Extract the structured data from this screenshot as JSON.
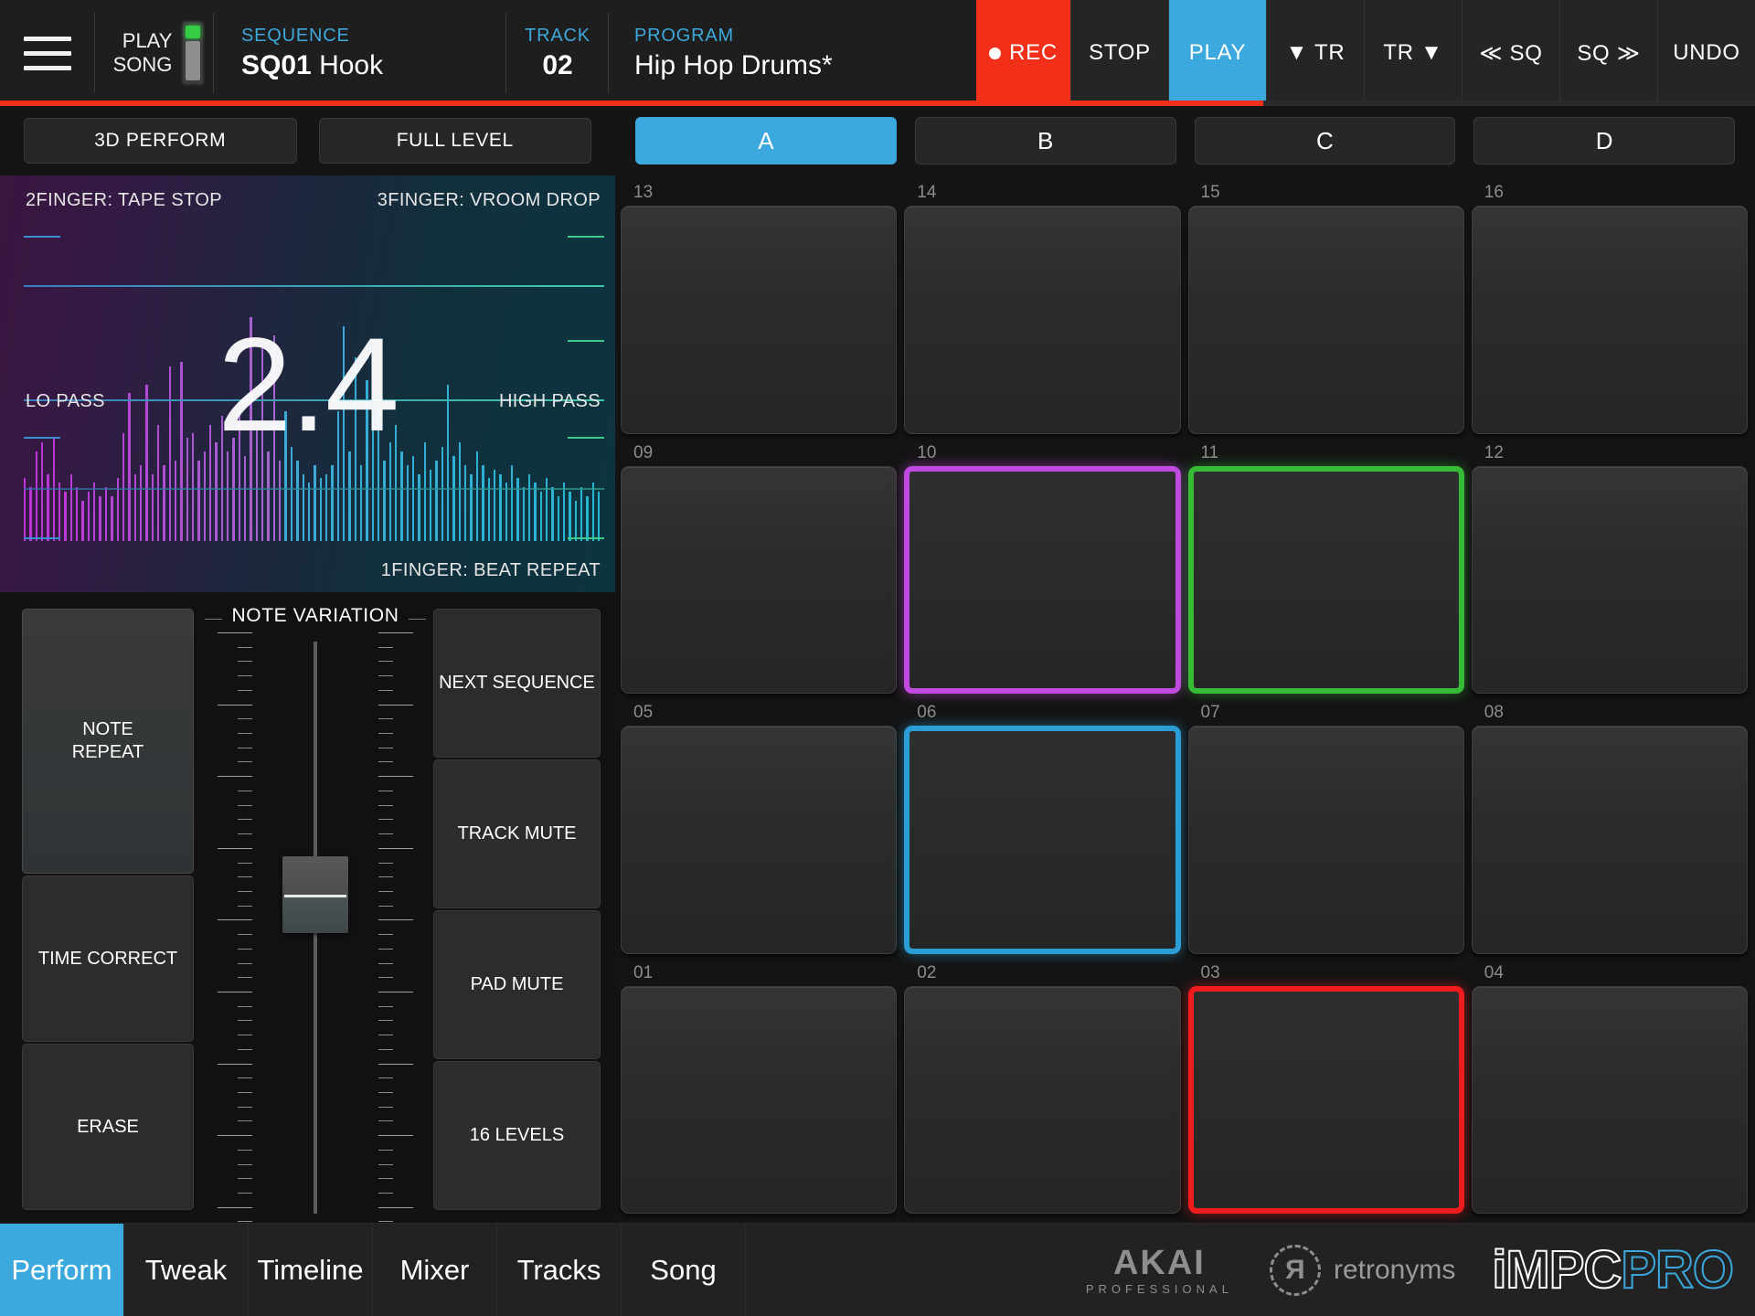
{
  "topbar": {
    "menu_icon": "hamburger-icon",
    "play_song_label_line1": "PLAY",
    "play_song_label_line2": "SONG",
    "sequence_caption": "SEQUENCE",
    "sequence_id": "SQ01",
    "sequence_name": "Hook",
    "track_caption": "TRACK",
    "track_value": "02",
    "program_caption": "PROGRAM",
    "program_value": "Hip Hop Drums*",
    "transport": [
      {
        "name": "rec-button",
        "label": "REC",
        "state": "armed",
        "color": "#f23019",
        "has_dot": true
      },
      {
        "name": "stop-button",
        "label": "STOP",
        "state": "idle",
        "color": "#252525",
        "has_dot": false
      },
      {
        "name": "play-button",
        "label": "PLAY",
        "state": "active",
        "color": "#3ba9dd",
        "has_dot": false
      },
      {
        "name": "track-prev-button",
        "label": "▼ TR",
        "state": "idle",
        "color": "#252525",
        "has_dot": false
      },
      {
        "name": "track-next-button",
        "label": "TR ▼",
        "state": "idle",
        "color": "#252525",
        "has_dot": false
      },
      {
        "name": "seq-prev-button",
        "label": "≪ SQ",
        "state": "idle",
        "color": "#252525",
        "has_dot": false
      },
      {
        "name": "seq-next-button",
        "label": "SQ ≫",
        "state": "idle",
        "color": "#252525",
        "has_dot": false
      },
      {
        "name": "undo-button",
        "label": "UNDO",
        "state": "idle",
        "color": "#252525",
        "has_dot": false
      }
    ],
    "progress_percent": 72,
    "progress_color": "#f23019"
  },
  "left_panel": {
    "mode_buttons": [
      {
        "name": "3d-perform-button",
        "label": "3D PERFORM"
      },
      {
        "name": "full-level-button",
        "label": "FULL LEVEL"
      }
    ],
    "xy_pad": {
      "top_left_label": "2FINGER: TAPE STOP",
      "top_right_label": "3FINGER: VROOM DROP",
      "left_label": "LO PASS",
      "right_label": "HIGH PASS",
      "bottom_right_label": "1FINGER: BEAT REPEAT",
      "value": "2.4"
    },
    "note_variation": {
      "title": "NOTE VARIATION",
      "value_percent": 62
    },
    "buttons_left": [
      {
        "name": "note-repeat-button",
        "label": "NOTE\nREPEAT"
      },
      {
        "name": "time-correct-button",
        "label": "TIME CORRECT"
      },
      {
        "name": "erase-button",
        "label": "ERASE"
      }
    ],
    "buttons_right": [
      {
        "name": "next-sequence-button",
        "label": "NEXT SEQUENCE"
      },
      {
        "name": "track-mute-button",
        "label": "TRACK MUTE"
      },
      {
        "name": "pad-mute-button",
        "label": "PAD MUTE"
      },
      {
        "name": "16-levels-button",
        "label": "16 LEVELS"
      }
    ]
  },
  "pad_section": {
    "banks": [
      {
        "name": "bank-a",
        "label": "A",
        "active": true
      },
      {
        "name": "bank-b",
        "label": "B",
        "active": false
      },
      {
        "name": "bank-c",
        "label": "C",
        "active": false
      },
      {
        "name": "bank-d",
        "label": "D",
        "active": false
      }
    ],
    "pads": [
      {
        "num": "13",
        "lit": null
      },
      {
        "num": "14",
        "lit": null
      },
      {
        "num": "15",
        "lit": null
      },
      {
        "num": "16",
        "lit": null
      },
      {
        "num": "09",
        "lit": null
      },
      {
        "num": "10",
        "lit": "purple"
      },
      {
        "num": "11",
        "lit": "green"
      },
      {
        "num": "12",
        "lit": null
      },
      {
        "num": "05",
        "lit": null
      },
      {
        "num": "06",
        "lit": "blue"
      },
      {
        "num": "07",
        "lit": null
      },
      {
        "num": "08",
        "lit": null
      },
      {
        "num": "01",
        "lit": null
      },
      {
        "num": "02",
        "lit": null
      },
      {
        "num": "03",
        "lit": "red"
      },
      {
        "num": "04",
        "lit": null
      }
    ],
    "lit_colors": {
      "purple": "#c04adf",
      "green": "#37bb37",
      "blue": "#2c9ed6",
      "red": "#ee1c1c"
    }
  },
  "bottom_nav": {
    "tabs": [
      {
        "name": "tab-perform",
        "label": "Perform",
        "active": true
      },
      {
        "name": "tab-tweak",
        "label": "Tweak",
        "active": false
      },
      {
        "name": "tab-timeline",
        "label": "Timeline",
        "active": false
      },
      {
        "name": "tab-mixer",
        "label": "Mixer",
        "active": false
      },
      {
        "name": "tab-tracks",
        "label": "Tracks",
        "active": false
      },
      {
        "name": "tab-song",
        "label": "Song",
        "active": false
      }
    ],
    "brands": {
      "akai_main": "AKAI",
      "akai_sub": "PROFESSIONAL",
      "retronyms": "retronyms",
      "impc": "iMPC",
      "impc_pro": "PRO"
    }
  }
}
